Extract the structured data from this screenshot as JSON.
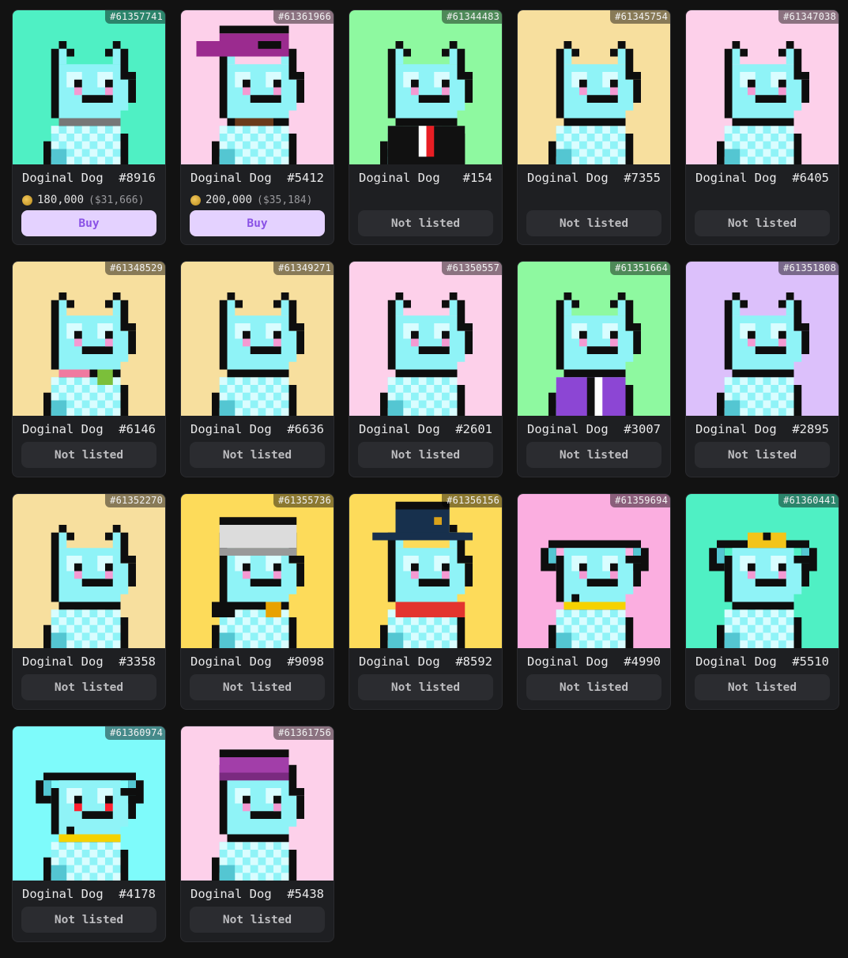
{
  "cards": [
    {
      "inscription": "#61357741",
      "name": "Doginal Dog",
      "number": "#8916",
      "bg": "#4ff0c4",
      "listed": true,
      "price": "180,000",
      "usd": "($31,666)",
      "button": "Buy",
      "acc": "grey-collar"
    },
    {
      "inscription": "#61361966",
      "name": "Doginal Dog",
      "number": "#5412",
      "bg": "#fdd0ea",
      "listed": true,
      "price": "200,000",
      "usd": "($35,184)",
      "button": "Buy",
      "acc": "cap"
    },
    {
      "inscription": "#61344483",
      "name": "Doginal Dog",
      "number": "#154",
      "bg": "#8ef9a0",
      "listed": false,
      "button": "Not listed",
      "acc": "suit"
    },
    {
      "inscription": "#61345754",
      "name": "Doginal Dog",
      "number": "#7355",
      "bg": "#f7df9e",
      "listed": false,
      "button": "Not listed",
      "acc": "none"
    },
    {
      "inscription": "#61347038",
      "name": "Doginal Dog",
      "number": "#6405",
      "bg": "#fdd0ea",
      "listed": false,
      "button": "Not listed",
      "acc": "none"
    },
    {
      "inscription": "#61348529",
      "name": "Doginal Dog",
      "number": "#6146",
      "bg": "#f7df9e",
      "listed": false,
      "button": "Not listed",
      "acc": "pink-collar"
    },
    {
      "inscription": "#61349271",
      "name": "Doginal Dog",
      "number": "#6636",
      "bg": "#f7df9e",
      "listed": false,
      "button": "Not listed",
      "acc": "none"
    },
    {
      "inscription": "#61350557",
      "name": "Doginal Dog",
      "number": "#2601",
      "bg": "#fdd0ea",
      "listed": false,
      "button": "Not listed",
      "acc": "none"
    },
    {
      "inscription": "#61351664",
      "name": "Doginal Dog",
      "number": "#3007",
      "bg": "#8ef9a0",
      "listed": false,
      "button": "Not listed",
      "acc": "purple-robe"
    },
    {
      "inscription": "#61351808",
      "name": "Doginal Dog",
      "number": "#2895",
      "bg": "#dcc0fb",
      "listed": false,
      "button": "Not listed",
      "acc": "none"
    },
    {
      "inscription": "#61352270",
      "name": "Doginal Dog",
      "number": "#3358",
      "bg": "#f7df9e",
      "listed": false,
      "button": "Not listed",
      "acc": "none"
    },
    {
      "inscription": "#61355736",
      "name": "Doginal Dog",
      "number": "#9098",
      "bg": "#fddb5a",
      "listed": false,
      "button": "Not listed",
      "acc": "beret"
    },
    {
      "inscription": "#61356156",
      "name": "Doginal Dog",
      "number": "#8592",
      "bg": "#fddb5a",
      "listed": false,
      "button": "Not listed",
      "acc": "cowboy"
    },
    {
      "inscription": "#61359694",
      "name": "Doginal Dog",
      "number": "#4990",
      "bg": "#fbaee0",
      "listed": false,
      "button": "Not listed",
      "acc": "gold-collar",
      "floppy": true
    },
    {
      "inscription": "#61360441",
      "name": "Doginal Dog",
      "number": "#5510",
      "bg": "#4ff0c4",
      "listed": false,
      "button": "Not listed",
      "acc": "bow",
      "floppy": true
    },
    {
      "inscription": "#61360974",
      "name": "Doginal Dog",
      "number": "#4178",
      "bg": "#7efbfb",
      "listed": false,
      "button": "Not listed",
      "acc": "gold-collar",
      "floppy": true,
      "red_eyes": true
    },
    {
      "inscription": "#61361756",
      "name": "Doginal Dog",
      "number": "#5438",
      "bg": "#fdd0ea",
      "listed": false,
      "button": "Not listed",
      "acc": "beanie"
    }
  ]
}
